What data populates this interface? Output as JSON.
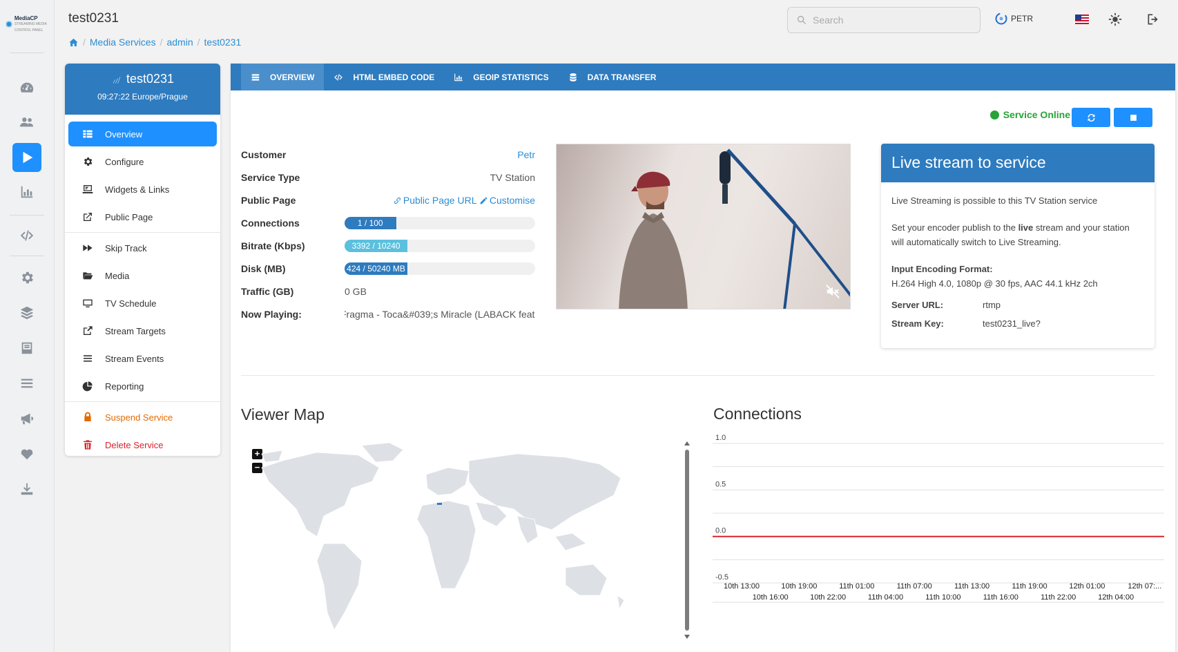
{
  "app": {
    "logo_text": "MediaCP",
    "logo_sub": "STREAMING MEDIA CONTROL PANEL"
  },
  "header": {
    "title": "test0231",
    "breadcrumb": [
      "Media Services",
      "admin",
      "test0231"
    ],
    "search_placeholder": "Search",
    "user": "PETR"
  },
  "rail": [
    "dashboard-icon",
    "users-icon",
    "play-icon",
    "chart-bar-icon",
    "code-icon",
    "gear-icon",
    "layers-icon",
    "inbox-icon",
    "list-icon",
    "megaphone-icon",
    "heartbeat-icon",
    "download-icon"
  ],
  "service": {
    "name": "test0231",
    "time": "09:27:22 Europe/Prague",
    "menu": [
      {
        "label": "Overview",
        "icon": "grid-icon"
      },
      {
        "label": "Configure",
        "icon": "gear-icon"
      },
      {
        "label": "Widgets & Links",
        "icon": "widget-icon"
      },
      {
        "label": "Public Page",
        "icon": "external-link-icon"
      },
      {
        "label": "Skip Track",
        "icon": "fast-forward-icon"
      },
      {
        "label": "Media",
        "icon": "folder-open-icon"
      },
      {
        "label": "TV Schedule",
        "icon": "monitor-icon"
      },
      {
        "label": "Stream Targets",
        "icon": "share-icon"
      },
      {
        "label": "Stream Events",
        "icon": "list-icon"
      },
      {
        "label": "Reporting",
        "icon": "pie-chart-icon"
      },
      {
        "label": "Suspend Service",
        "icon": "lock-icon"
      },
      {
        "label": "Delete Service",
        "icon": "trash-icon"
      }
    ]
  },
  "tabs": [
    "OVERVIEW",
    "HTML EMBED CODE",
    "GEOIP STATISTICS",
    "DATA TRANSFER"
  ],
  "status": "Service Online",
  "overview": {
    "customer_label": "Customer",
    "customer": "Petr",
    "service_type_label": "Service Type",
    "service_type": "TV Station",
    "public_page_label": "Public Page",
    "public_page_link": "Public Page URL",
    "customise_link": "Customise",
    "connections_label": "Connections",
    "connections_text": "1 / 100",
    "connections_fraction": 0.27,
    "bitrate_label": "Bitrate (Kbps)",
    "bitrate_text": "3392 / 10240",
    "bitrate_fraction": 0.33,
    "disk_label": "Disk (MB)",
    "disk_text": "424 / 50240 MB",
    "disk_fraction": 0.33,
    "traffic_label": "Traffic (GB)",
    "traffic": "0 GB",
    "now_playing_label": "Now Playing:",
    "now_playing": "Fragma - Toca&#039;s Miracle (LABACK feat."
  },
  "live": {
    "title": "Live stream to service",
    "p1": "Live Streaming is possible to this TV Station service",
    "p2_a": "Set your encoder publish to the ",
    "p2_b": "live",
    "p2_c": " stream and your station will automatically switch to Live Streaming.",
    "format_label": "Input Encoding Format:",
    "format": "H.264 High 4.0, 1080p @ 30 fps, AAC 44.1 kHz 2ch",
    "server_label": "Server URL:",
    "server": "rtmp",
    "key_label": "Stream Key:",
    "key": "test0231_live?"
  },
  "viewer_map": {
    "title": "Viewer Map",
    "zoom_in": "+",
    "zoom_out": "−"
  },
  "connections_chart": {
    "title": "Connections"
  },
  "chart_data": {
    "type": "line",
    "y_ticks": [
      "1.0",
      "0.5",
      "0.0",
      "-0.5"
    ],
    "ylim": [
      -0.5,
      1.0
    ],
    "x_labels_top": [
      "10th 13:00",
      "10th 19:00",
      "11th 01:00",
      "11th 07:00",
      "11th 13:00",
      "11th 19:00",
      "12th 01:00",
      "12th 07:..."
    ],
    "x_labels_bottom": [
      "10th 16:00",
      "10th 22:00",
      "11th 04:00",
      "11th 10:00",
      "11th 16:00",
      "11th 22:00",
      "12th 04:00"
    ],
    "series": [
      {
        "values": [
          0,
          0,
          0,
          0,
          0,
          0,
          0,
          0,
          0,
          0,
          0,
          0,
          0,
          0,
          0
        ],
        "color": "#d9232c"
      }
    ],
    "grid": true
  }
}
